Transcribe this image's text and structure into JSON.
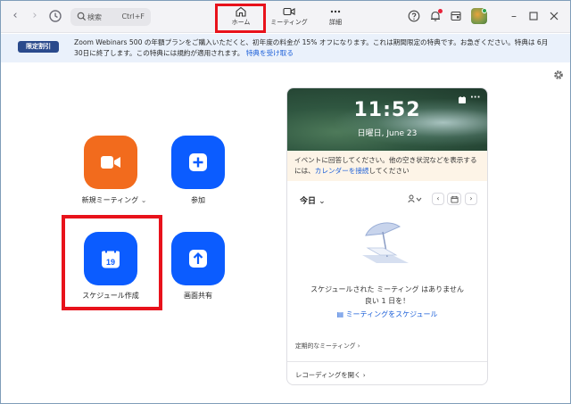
{
  "titlebar": {
    "search_placeholder": "検索",
    "search_shortcut": "Ctrl+F",
    "tabs": [
      {
        "label": "ホーム",
        "icon": "home-icon"
      },
      {
        "label": "ミーティング",
        "icon": "video-camera-icon"
      },
      {
        "label": "詳細",
        "icon": "more-dots-icon"
      }
    ]
  },
  "banner": {
    "badge": "限定割引",
    "text": "Zoom Webinars 500 の年額プランをご購入いただくと、初年度の料金が 15% オフになります。これは期間限定の特典です。お急ぎください。特典は 6月 30日に終了します。この特典には規約が適用されます。",
    "link": "特典を受け取る"
  },
  "actions": {
    "new_meeting": "新規ミーティング",
    "join": "参加",
    "schedule": "スケジュール作成",
    "calendar_day": "19",
    "share_screen": "画面共有"
  },
  "card": {
    "time": "11:52",
    "date": "日曜日, June 23",
    "note_text": "イベントに回答してください。他の空き状況などを表示するには、",
    "note_link": "カレンダーを接続",
    "note_tail": "してください",
    "today": "今日",
    "empty_line1": "スケジュールされた ミーティング はありません",
    "empty_line2": "良い 1 日を！",
    "schedule_link": "ミーティングをスケジュール",
    "recurring": "定期的なミーティング",
    "recording": "レコーディングを開く"
  },
  "colors": {
    "new_meeting": "#f26b1d",
    "action_blue": "#0b5cff",
    "highlight": "#e8121b"
  }
}
